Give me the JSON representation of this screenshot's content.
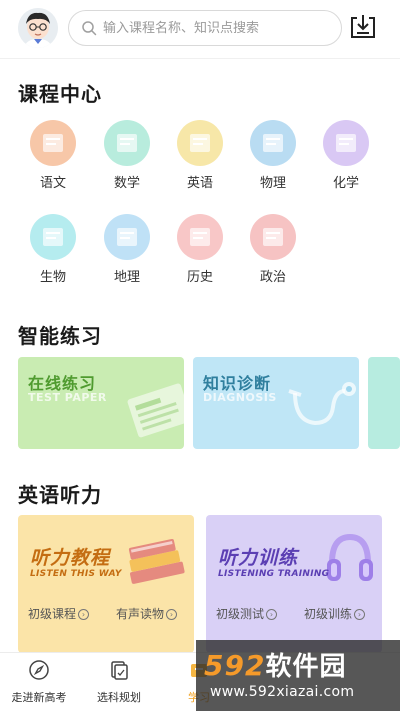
{
  "header": {
    "search_placeholder": "输入课程名称、知识点搜索"
  },
  "sections": {
    "courses_title": "课程中心",
    "practice_title": "智能练习",
    "listening_title": "英语听力"
  },
  "subjects": [
    {
      "label": "语文",
      "icon": "chinese-book-icon",
      "color": "#f7c7a8"
    },
    {
      "label": "数学",
      "icon": "math-compass-icon",
      "color": "#b8ecdd"
    },
    {
      "label": "英语",
      "icon": "english-board-icon",
      "color": "#f7e7a8"
    },
    {
      "label": "物理",
      "icon": "physics-device-icon",
      "color": "#b9dcf2"
    },
    {
      "label": "化学",
      "icon": "chemistry-flask-icon",
      "color": "#d9c8f4"
    },
    {
      "label": "生物",
      "icon": "biology-microscope-icon",
      "color": "#b5ecef"
    },
    {
      "label": "地理",
      "icon": "geography-building-icon",
      "color": "#bfe1f6"
    },
    {
      "label": "历史",
      "icon": "history-pen-icon",
      "color": "#f8c7c7"
    },
    {
      "label": "政治",
      "icon": "politics-scale-icon",
      "color": "#f6c3c3"
    }
  ],
  "practice": [
    {
      "title": "在线练习",
      "subtitle": "TEST PAPER",
      "bg": "#c9ecb2",
      "fg": "#4f9b2f"
    },
    {
      "title": "知识诊断",
      "subtitle": "DIAGNOSIS",
      "bg": "#bfe6f6",
      "fg": "#2f7f9e"
    }
  ],
  "listening": [
    {
      "title": "听力教程",
      "subtitle": "LISTEN THIS WAY",
      "bg": "#fbe4a8",
      "fg": "#c46d12",
      "links": [
        "初级课程",
        "有声读物"
      ]
    },
    {
      "title": "听力训练",
      "subtitle": "LISTENING TRAINING",
      "bg": "#d9d0f6",
      "fg": "#5b3fb3",
      "links": [
        "初级测试",
        "初级训练"
      ]
    }
  ],
  "bottom_nav": [
    {
      "label": "走进新高考",
      "icon": "compass-icon"
    },
    {
      "label": "选科规划",
      "icon": "plan-icon"
    },
    {
      "label": "学习",
      "icon": "study-icon"
    }
  ],
  "watermark": {
    "number": "592",
    "name": "软件园",
    "url": "www.592xiazai.com"
  }
}
